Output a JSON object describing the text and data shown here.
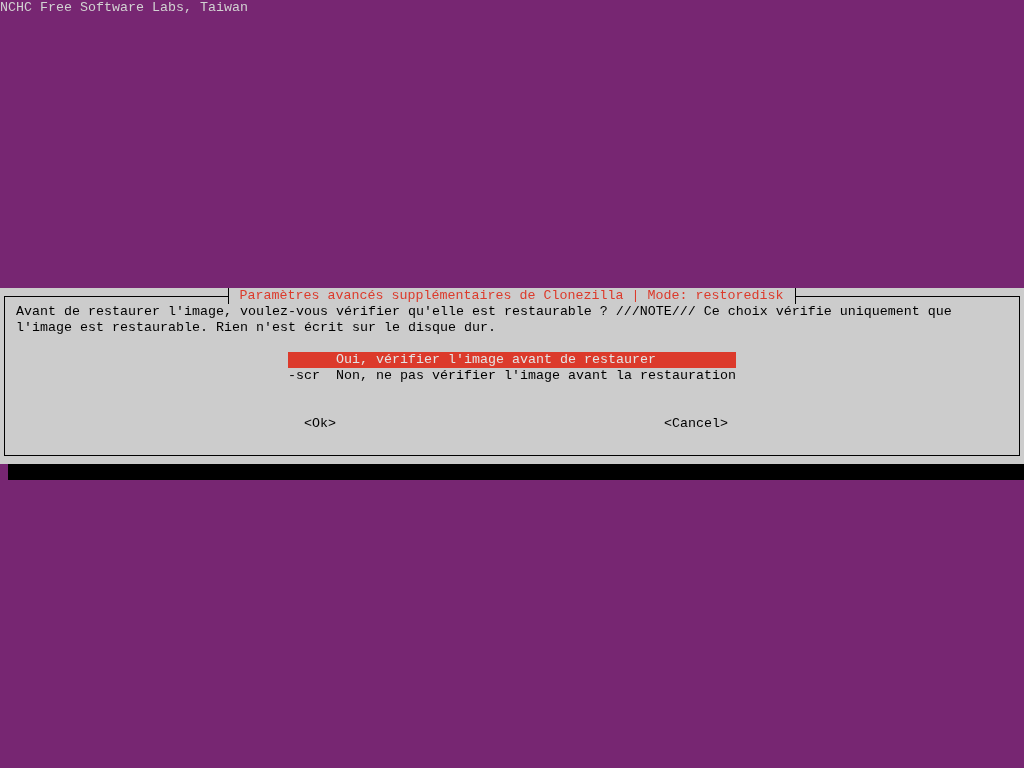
{
  "header": {
    "text": "NCHC Free Software Labs, Taiwan"
  },
  "dialog": {
    "title": "Paramètres avancés supplémentaires de Clonezilla | Mode: restoredisk",
    "message": "Avant de restaurer l'image, voulez-vous vérifier qu'elle est restaurable ? ///NOTE/// Ce choix vérifie uniquement que l'image est restaurable. Rien n'est écrit sur le disque dur.",
    "menu": [
      {
        "label": "Oui, vérifier l'image avant de restaurer",
        "selected": true
      },
      {
        "tag": "-scr",
        "label": "Non, ne pas vérifier l'image avant la restauration",
        "selected": false
      }
    ],
    "buttons": [
      {
        "label": "<Ok>",
        "selected": false
      },
      {
        "label": "<Cancel>",
        "selected": false
      }
    ]
  }
}
